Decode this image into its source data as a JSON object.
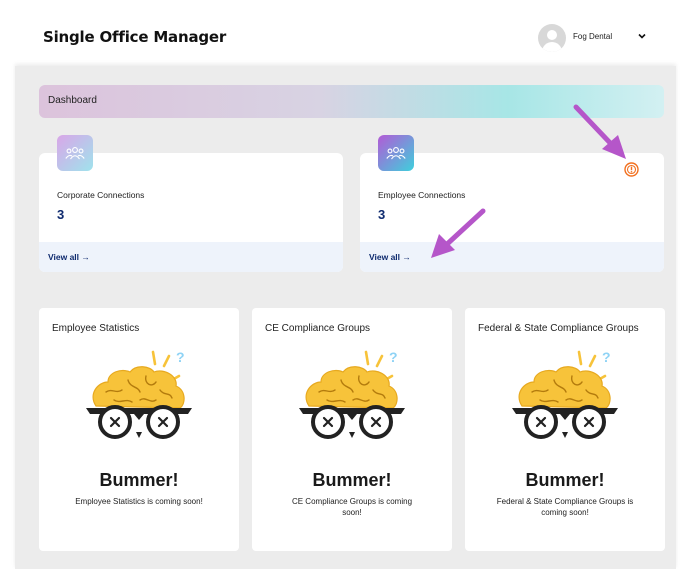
{
  "header": {
    "app_title": "Single Office Manager",
    "user_name": "Fog Dental"
  },
  "banner": {
    "title": "Dashboard"
  },
  "connections": [
    {
      "label": "Corporate Connections",
      "count": "3",
      "link": "View all →"
    },
    {
      "label": "Employee Connections",
      "count": "3",
      "link": "View all →"
    }
  ],
  "stats": [
    {
      "title": "Employee Statistics",
      "heading": "Bummer!",
      "message": "Employee Statistics is coming soon!"
    },
    {
      "title": "CE Compliance Groups",
      "heading": "Bummer!",
      "message": "CE Compliance Groups is coming soon!"
    },
    {
      "title": "Federal & State Compliance Groups",
      "heading": "Bummer!",
      "message": "Federal & State Compliance Groups is coming soon!"
    }
  ],
  "colors": {
    "accent_navy": "#0e2a6e",
    "warning_orange": "#f2701f",
    "annotation_purple": "#b556c9",
    "brain_yellow": "#f7c33a"
  },
  "icons": {
    "badge": "people-group-icon",
    "warning": "warning-circle-icon",
    "dropdown": "chevron-down-icon"
  }
}
